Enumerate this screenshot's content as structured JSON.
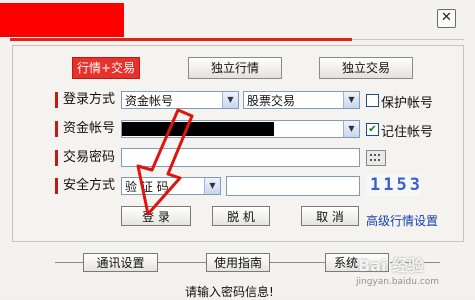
{
  "window": {
    "close_glyph": "✕"
  },
  "tabs": [
    {
      "label": "行情+交易",
      "active": true
    },
    {
      "label": "独立行情",
      "active": false
    },
    {
      "label": "独立交易",
      "active": false
    }
  ],
  "form": {
    "login_mode_label": "登录方式",
    "login_mode_value": "资金帐号",
    "trade_type_value": "股票交易",
    "protect_account_label": "保护帐号",
    "account_label": "资金帐号",
    "remember_account_label": "记住帐号",
    "trade_password_label": "交易密码",
    "security_mode_label": "安全方式",
    "security_mode_value": "验 证 码",
    "captcha_text": "1153"
  },
  "buttons": {
    "login": "登 录",
    "offline": "脱 机",
    "cancel": "取 消",
    "advanced_quotes": "高级行情设置"
  },
  "footer": {
    "comm_settings": "通讯设置",
    "user_guide": "使用指南",
    "system": "系统",
    "status_text": "请输入密码信息!"
  },
  "watermark": {
    "text": "Bai 经验",
    "url_text": "jingyan.baidu.com"
  },
  "colors": {
    "accent": "#e8312a",
    "panel_border": "#c8c4be"
  },
  "icons": [
    "close-icon",
    "dropdown-arrow-icon",
    "keyboard-icon",
    "annotation-arrow-icon"
  ]
}
